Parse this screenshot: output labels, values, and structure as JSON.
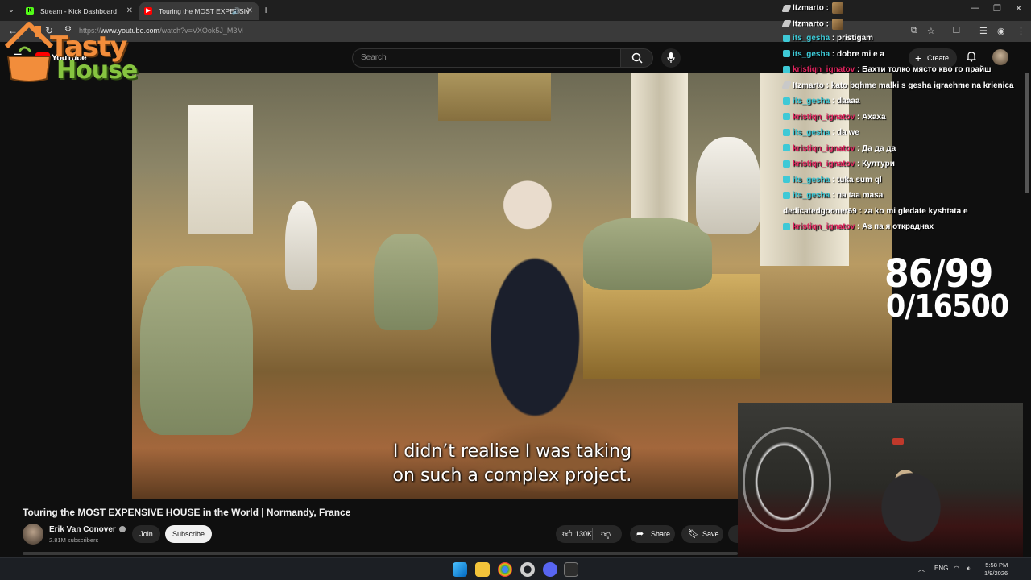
{
  "browser": {
    "tabs": [
      {
        "label": "Stream - Kick Dashboard",
        "favicon": "kick-icon",
        "color": "#53fc18"
      },
      {
        "label": "Touring the MOST EXPENSIV",
        "favicon": "youtube-icon",
        "color": "#ff0000",
        "active": true
      }
    ],
    "url_prefix": "https://",
    "url_host": "www.youtube.com",
    "url_path": "/watch?v=VXOok5J_M3M"
  },
  "youtube": {
    "logo_text": "YouTube",
    "search_placeholder": "Search",
    "create_label": "Create"
  },
  "overlay_logo": {
    "word1": "Tasty",
    "word2": "House"
  },
  "video": {
    "subtitle_line1": "I didn’t realise I was taking",
    "subtitle_line2": "on such a complex project."
  },
  "video_info": {
    "title": "Touring the MOST EXPENSIVE HOUSE in the World | Normandy, France",
    "channel": "Erik Van Conover",
    "subscribers": "2.81M subscribers",
    "join_label": "Join",
    "subscribe_label": "Subscribe",
    "likes": "130K",
    "share_label": "Share",
    "save_label": "Save"
  },
  "chat": {
    "messages": [
      {
        "user": "Itzmarto",
        "sep": " :",
        "text": "",
        "badge": "pen",
        "color": "#ffffff",
        "emote": true
      },
      {
        "user": "Itzmarto",
        "sep": " :",
        "text": "",
        "badge": "pen",
        "color": "#ffffff",
        "emote": true
      },
      {
        "user": "its_gesha",
        "sep": " : ",
        "text": "pristigam",
        "badge": "mod",
        "color": "#3ec9d6"
      },
      {
        "user": "its_gesha",
        "sep": " : ",
        "text": "dobre mi e a",
        "badge": "mod",
        "color": "#3ec9d6"
      },
      {
        "user": "kristiqn_ignatov",
        "sep": " : ",
        "text": "Бахти толко място кво го прайш",
        "badge": "mod",
        "color": "#e0245e"
      },
      {
        "user": "Itzmarto",
        "sep": " : ",
        "text": "kato bqhme malki s gesha igraehme na krienica",
        "badge": "pen",
        "color": "#ffffff"
      },
      {
        "user": "its_gesha",
        "sep": " : ",
        "text": "daaaa",
        "badge": "mod",
        "color": "#3ec9d6"
      },
      {
        "user": "kristiqn_ignatov",
        "sep": " : ",
        "text": "Ахаха",
        "badge": "mod",
        "color": "#e0245e"
      },
      {
        "user": "its_gesha",
        "sep": " : ",
        "text": "da we",
        "badge": "mod",
        "color": "#3ec9d6"
      },
      {
        "user": "kristiqn_ignatov",
        "sep": " : ",
        "text": "Да да да",
        "badge": "mod",
        "color": "#e0245e"
      },
      {
        "user": "kristiqn_ignatov",
        "sep": " : ",
        "text": "Култури",
        "badge": "mod",
        "color": "#e0245e"
      },
      {
        "user": "its_gesha",
        "sep": " : ",
        "text": "tuka sum ql",
        "badge": "mod",
        "color": "#3ec9d6"
      },
      {
        "user": "its_gesha",
        "sep": " : ",
        "text": "na taa masa",
        "badge": "mod",
        "color": "#3ec9d6"
      },
      {
        "user": "dedicatedgooner69",
        "sep": " : ",
        "text": "za ko mi gledate kyshtata e",
        "badge": "",
        "color": "#ffffff"
      },
      {
        "user": "kristiqn_ignatov",
        "sep": " : ",
        "text": "Аз па я откраднах",
        "badge": "mod",
        "color": "#e0245e"
      }
    ]
  },
  "counters": {
    "line1": "86/99",
    "line2": "0/16500"
  },
  "taskbar": {
    "lang": "ENG",
    "time": "5:58 PM",
    "date": "1/9/2026"
  }
}
